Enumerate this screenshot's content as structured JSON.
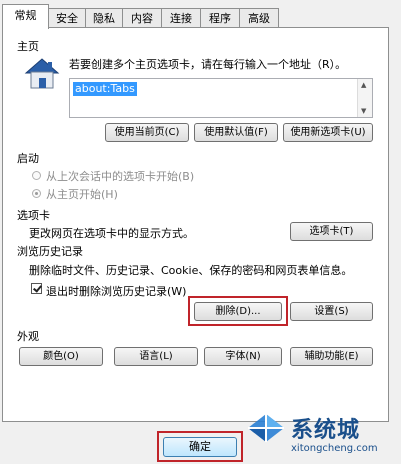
{
  "tabs": [
    "常规",
    "安全",
    "隐私",
    "内容",
    "连接",
    "程序",
    "高级"
  ],
  "home_page": {
    "section_label": "主页",
    "instruction": "若要创建多个主页选项卡，请在每行输入一个地址（R）。",
    "address_value": "about:Tabs",
    "use_current_button": "使用当前页(C)",
    "use_default_button": "使用默认值(F)",
    "use_new_tab_button": "使用新选项卡(U)"
  },
  "startup": {
    "section_label": "启动",
    "option_last_session": "从上次会话中的选项卡开始(B)",
    "option_home_page": "从主页开始(H)",
    "selected": "option_home_page"
  },
  "tabs_section": {
    "section_label": "选项卡",
    "description": "更改网页在选项卡中的显示方式。",
    "button": "选项卡(T)"
  },
  "history": {
    "section_label": "浏览历史记录",
    "description": "删除临时文件、历史记录、Cookie、保存的密码和网页表单信息。",
    "checkbox_label": "退出时删除浏览历史记录(W)",
    "checkbox_checked": true,
    "delete_button": "删除(D)...",
    "settings_button": "设置(S)"
  },
  "appearance": {
    "section_label": "外观",
    "colors_button": "颜色(O)",
    "languages_button": "语言(L)",
    "fonts_button": "字体(N)",
    "accessibility_button": "辅助功能(E)"
  },
  "footer": {
    "ok_button": "确定"
  },
  "watermark": {
    "brand": "系统城",
    "url": "xitongcheng.com"
  },
  "colors": {
    "highlight_red": "#c0242a",
    "selection_blue": "#3399ff"
  },
  "icons": {
    "home": "house-icon",
    "watermark_logo": "windows-logo-icon"
  }
}
